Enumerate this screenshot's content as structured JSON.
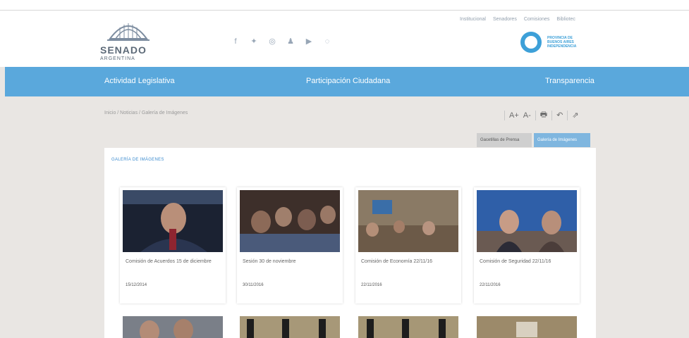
{
  "brand": {
    "name": "SENADO",
    "country": "ARGENTINA"
  },
  "top_links": [
    "Institucional",
    "Senadores",
    "Comisiones",
    "Bibliotec"
  ],
  "social_icons": [
    "facebook-icon",
    "twitter-icon",
    "instagram-icon",
    "user-icon",
    "youtube-icon",
    "rss-icon"
  ],
  "badge": {
    "line1": "PROVINCIA DE",
    "line2": "BUENOS AIRES",
    "line3": "INDEPENDENCIA"
  },
  "nav": {
    "items": [
      "Actividad Legislativa",
      "Participación Ciudadana",
      "Transparencia"
    ]
  },
  "breadcrumb": {
    "text": "Inicio  /  Noticias  /  Galería de Imágenes"
  },
  "tools": {
    "font_up": "A+",
    "font_down": "A-",
    "print_icon": "print-icon",
    "back_icon": "back-icon",
    "share_icon": "share-icon"
  },
  "tabs": {
    "press": "Gacetillas de Prensa",
    "gallery": "Galería de Imágenes"
  },
  "gallery": {
    "title": "GALERÍA DE IMÁGENES",
    "items": [
      {
        "caption": "Comisión de Acuerdos 15 de diciembre",
        "date": "15/12/2014"
      },
      {
        "caption": "Sesión 30 de noviembre",
        "date": "30/11/2016"
      },
      {
        "caption": "Comisión de Economía 22/11/16",
        "date": "22/11/2016"
      },
      {
        "caption": "Comisión de Seguridad 22/11/16",
        "date": "22/11/2016"
      }
    ]
  },
  "colors": {
    "accent": "#5aa8dc",
    "badge": "#3da0d8",
    "page_bg": "#e9e6e3"
  }
}
